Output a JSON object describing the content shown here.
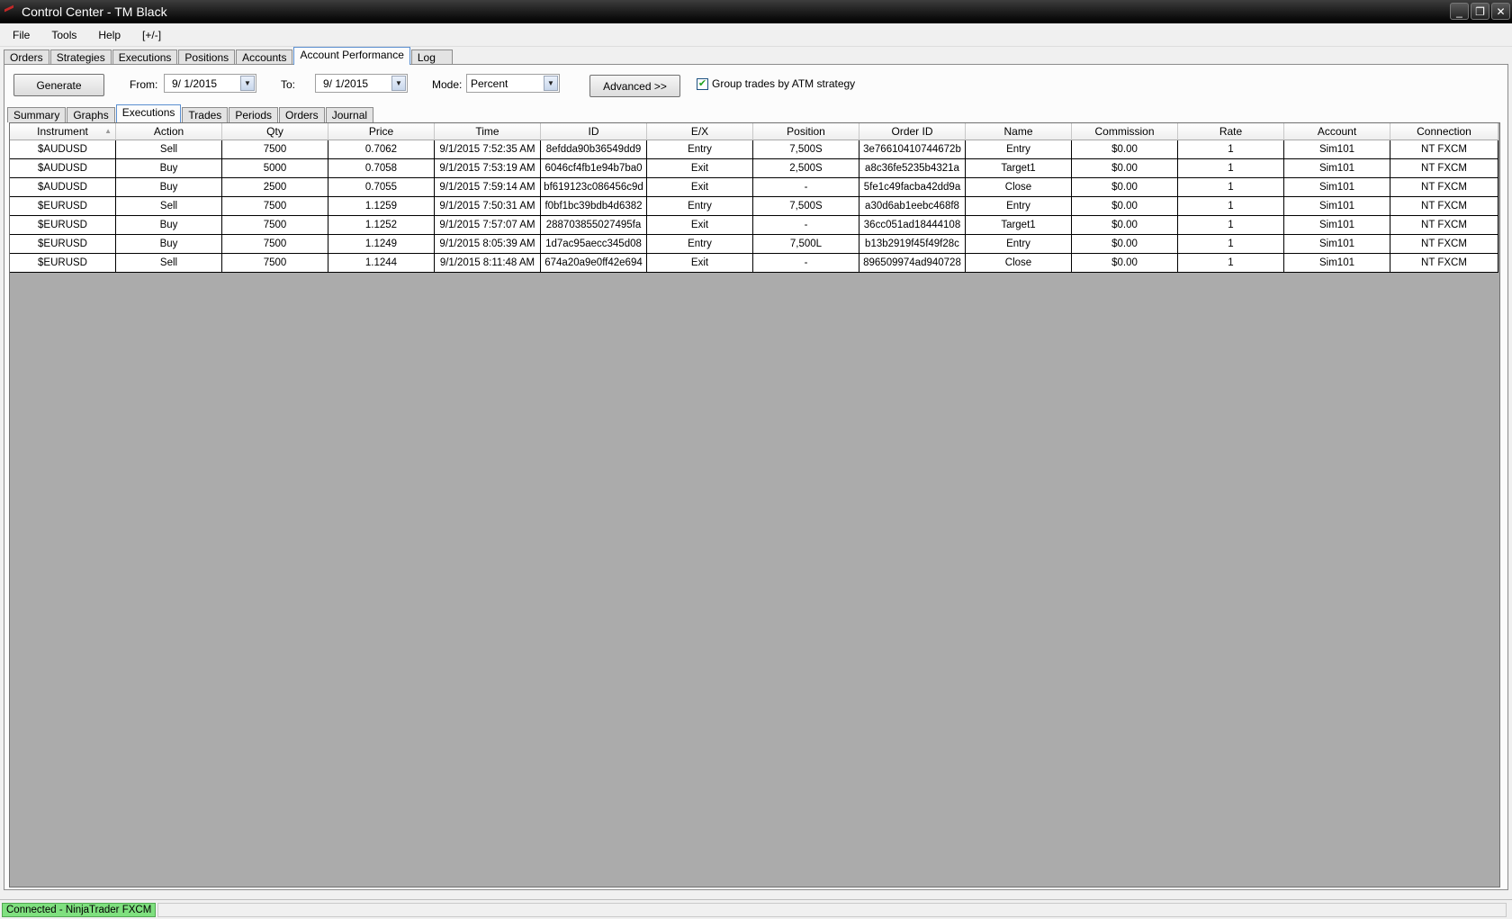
{
  "window": {
    "title": "Control Center - TM Black",
    "controls": [
      "_",
      "❐",
      "✕"
    ]
  },
  "menu": [
    "File",
    "Tools",
    "Help",
    "[+/-]"
  ],
  "main_tabs": [
    "Orders",
    "Strategies",
    "Executions",
    "Positions",
    "Accounts",
    "Account Performance",
    "Log"
  ],
  "main_tab_active": "Account Performance",
  "toolbar": {
    "generate": "Generate",
    "from_label": "From:",
    "from_value": "9/  1/2015",
    "to_label": "To:",
    "to_value": "9/  1/2015",
    "mode_label": "Mode:",
    "mode_value": "Percent",
    "advanced": "Advanced >>",
    "group_trades_label": "Group trades by ATM strategy",
    "group_trades_checked": true
  },
  "sub_tabs": [
    "Summary",
    "Graphs",
    "Executions",
    "Trades",
    "Periods",
    "Orders",
    "Journal"
  ],
  "sub_tab_active": "Executions",
  "table": {
    "columns": [
      "Instrument",
      "Action",
      "Qty",
      "Price",
      "Time",
      "ID",
      "E/X",
      "Position",
      "Order ID",
      "Name",
      "Commission",
      "Rate",
      "Account",
      "Connection"
    ],
    "rows": [
      [
        "$AUDUSD",
        "Sell",
        "7500",
        "0.7062",
        "9/1/2015 7:52:35 AM",
        "8efdda90b36549dd9",
        "Entry",
        "7,500S",
        "3e76610410744672b",
        "Entry",
        "$0.00",
        "1",
        "Sim101",
        "NT FXCM"
      ],
      [
        "$AUDUSD",
        "Buy",
        "5000",
        "0.7058",
        "9/1/2015 7:53:19 AM",
        "6046cf4fb1e94b7ba0",
        "Exit",
        "2,500S",
        "a8c36fe5235b4321a",
        "Target1",
        "$0.00",
        "1",
        "Sim101",
        "NT FXCM"
      ],
      [
        "$AUDUSD",
        "Buy",
        "2500",
        "0.7055",
        "9/1/2015 7:59:14 AM",
        "bf619123c086456c9d",
        "Exit",
        "-",
        "5fe1c49facba42dd9a",
        "Close",
        "$0.00",
        "1",
        "Sim101",
        "NT FXCM"
      ],
      [
        "$EURUSD",
        "Sell",
        "7500",
        "1.1259",
        "9/1/2015 7:50:31 AM",
        "f0bf1bc39bdb4d6382",
        "Entry",
        "7,500S",
        "a30d6ab1eebc468f8",
        "Entry",
        "$0.00",
        "1",
        "Sim101",
        "NT FXCM"
      ],
      [
        "$EURUSD",
        "Buy",
        "7500",
        "1.1252",
        "9/1/2015 7:57:07 AM",
        "288703855027495fa",
        "Exit",
        "-",
        "36cc051ad18444108",
        "Target1",
        "$0.00",
        "1",
        "Sim101",
        "NT FXCM"
      ],
      [
        "$EURUSD",
        "Buy",
        "7500",
        "1.1249",
        "9/1/2015 8:05:39 AM",
        "1d7ac95aecc345d08",
        "Entry",
        "7,500L",
        "b13b2919f45f49f28c",
        "Entry",
        "$0.00",
        "1",
        "Sim101",
        "NT FXCM"
      ],
      [
        "$EURUSD",
        "Sell",
        "7500",
        "1.1244",
        "9/1/2015 8:11:48 AM",
        "674a20a9e0ff42e694",
        "Exit",
        "-",
        "896509974ad940728",
        "Close",
        "$0.00",
        "1",
        "Sim101",
        "NT FXCM"
      ]
    ]
  },
  "status": {
    "connection": "Connected - NinjaTrader FXCM"
  },
  "colors": {
    "connected": "#7fe07f",
    "grid_background": "#ababab",
    "title_bar": "#1a1a1a"
  }
}
